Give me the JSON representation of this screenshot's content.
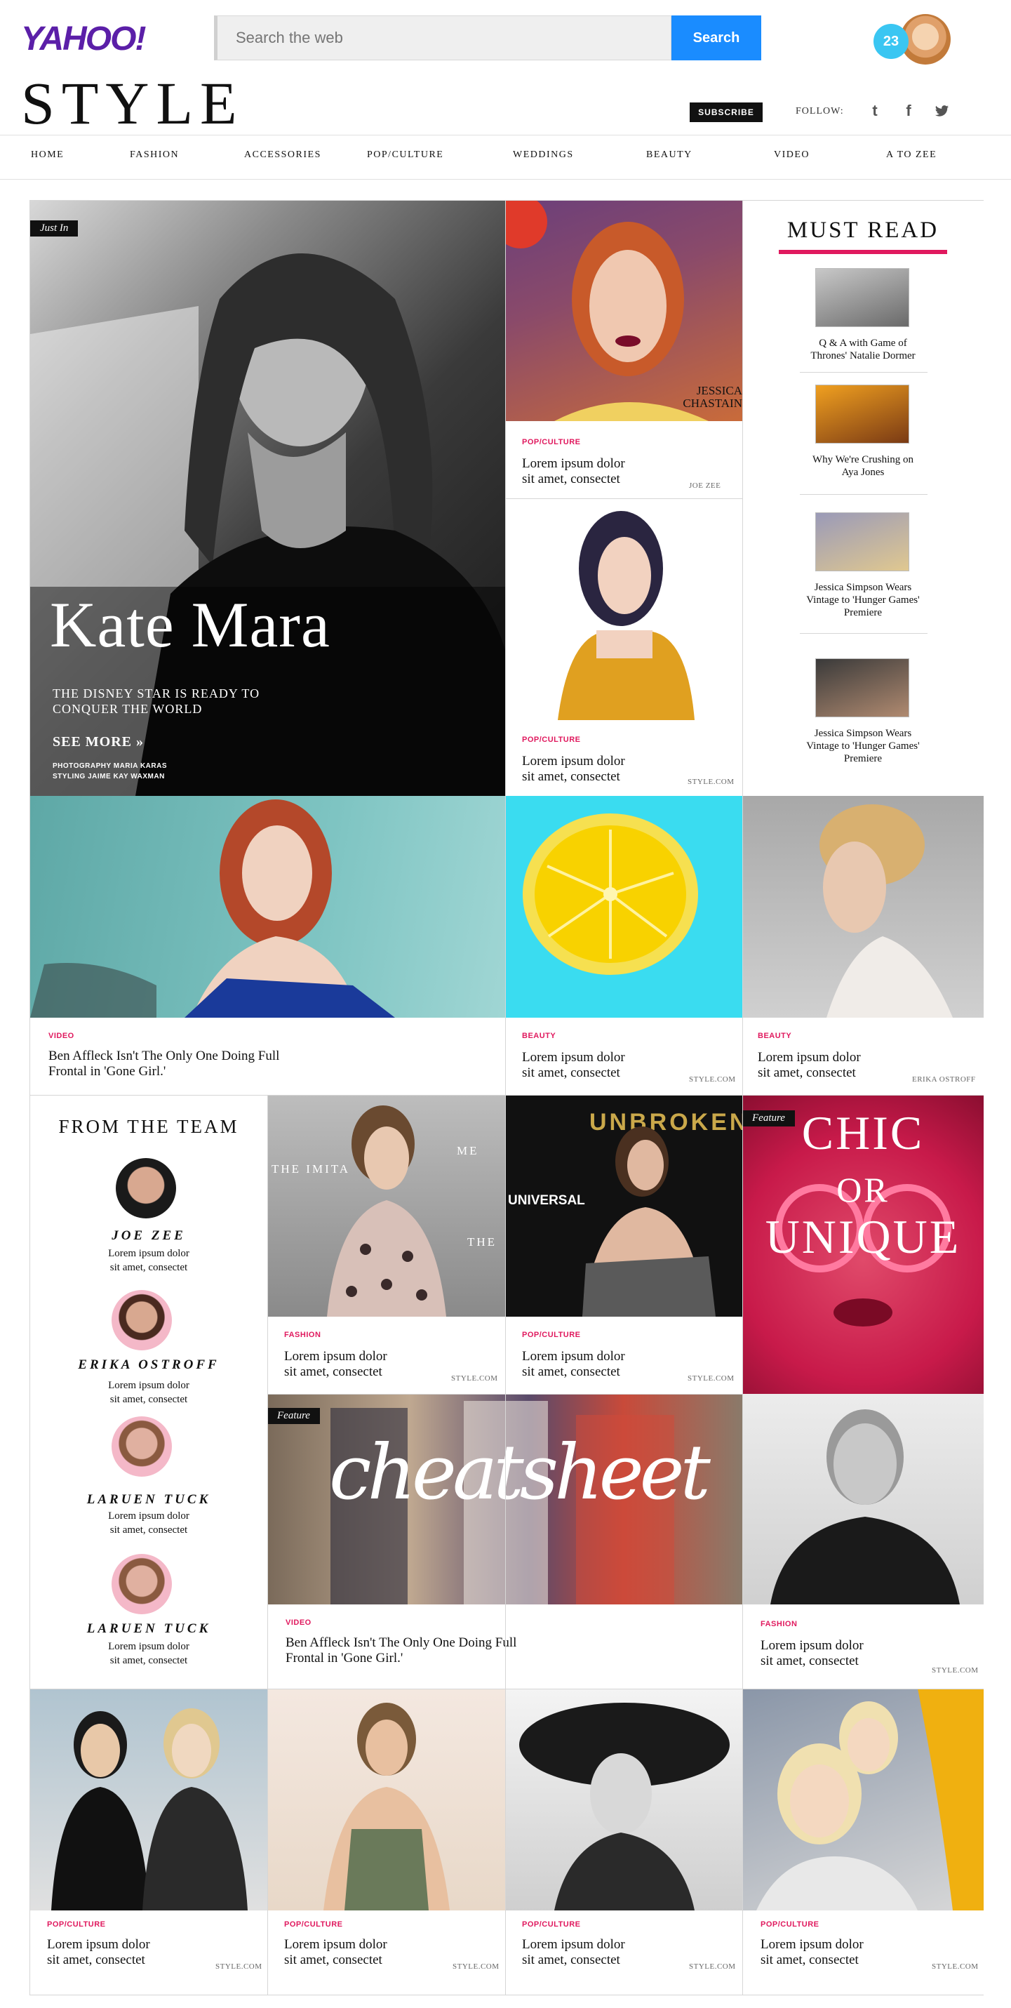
{
  "header": {
    "logo": "YAHOO!",
    "search_placeholder": "Search the web",
    "search_button": "Search",
    "notification_count": "23",
    "brand": "STYLE",
    "subscribe": "SUBSCRIBE",
    "follow_label": "FOLLOW:",
    "social": [
      "t",
      "f",
      "✔"
    ]
  },
  "nav": [
    "HOME",
    "FASHION",
    "ACCESSORIES",
    "POP/CULTURE",
    "WEDDINGS",
    "BEAUTY",
    "VIDEO",
    "A TO ZEE"
  ],
  "hero": {
    "tag": "Just In",
    "title": "Kate Mara",
    "subtitle_1": "THE DISNEY STAR IS READY TO",
    "subtitle_2": "CONQUER THE WORLD",
    "see_more": "SEE MORE »",
    "credit_1": "PHOTOGRAPHY MARIA KARAS",
    "credit_2": "STYLING JAIME KAY WAXMAN"
  },
  "jessica_overlay": {
    "line1": "JESSICA",
    "line2": "CHASTAIN"
  },
  "must_read": {
    "title": "MUST READ",
    "items": [
      {
        "l1": "Q & A with Game of",
        "l2": "Thrones' Natalie Dormer",
        "l3": ""
      },
      {
        "l1": "Why We're Crushing on",
        "l2": "Aya Jones",
        "l3": ""
      },
      {
        "l1": "Jessica Simpson Wears",
        "l2": "Vintage to 'Hunger Games'",
        "l3": "Premiere"
      },
      {
        "l1": "Jessica Simpson Wears",
        "l2": "Vintage to 'Hunger Games'",
        "l3": "Premiere"
      }
    ]
  },
  "cards": {
    "c1": {
      "cat": "POP/CULTURE",
      "l1": "Lorem ipsum dolor",
      "l2": "sit amet, consectet",
      "src": "JOE ZEE"
    },
    "c2": {
      "cat": "POP/CULTURE",
      "l1": "Lorem ipsum dolor",
      "l2": "sit amet, consectet",
      "src": "STYLE.COM"
    },
    "c3": {
      "cat": "VIDEO",
      "l1": "Ben Affleck Isn't The Only One Doing Full",
      "l2": "Frontal in 'Gone Girl.'",
      "src": ""
    },
    "c4": {
      "cat": "BEAUTY",
      "l1": "Lorem ipsum dolor",
      "l2": "sit amet, consectet",
      "src": "STYLE.COM"
    },
    "c5": {
      "cat": "BEAUTY",
      "l1": "Lorem ipsum dolor",
      "l2": "sit amet, consectet",
      "src": "ERIKA OSTROFF"
    },
    "c6": {
      "cat": "FASHION",
      "l1": "Lorem ipsum dolor",
      "l2": "sit amet, consectet",
      "src": "STYLE.COM"
    },
    "c7": {
      "cat": "POP/CULTURE",
      "l1": "Lorem ipsum dolor",
      "l2": "sit amet, consectet",
      "src": "STYLE.COM"
    },
    "c8": {
      "cat": "VIDEO",
      "l1": "Ben Affleck Isn't The Only One Doing Full",
      "l2": "Frontal in 'Gone Girl.'",
      "src": ""
    },
    "c9": {
      "cat": "FASHION",
      "l1": "Lorem ipsum dolor",
      "l2": "sit amet, consectet",
      "src": "STYLE.COM"
    },
    "c10": {
      "cat": "POP/CULTURE",
      "l1": "Lorem ipsum dolor",
      "l2": "sit amet, consectet",
      "src": "STYLE.COM"
    },
    "c11": {
      "cat": "POP/CULTURE",
      "l1": "Lorem ipsum dolor",
      "l2": "sit amet, consectet",
      "src": "STYLE.COM"
    },
    "c12": {
      "cat": "POP/CULTURE",
      "l1": "Lorem ipsum dolor",
      "l2": "sit amet, consectet",
      "src": "STYLE.COM"
    },
    "c13": {
      "cat": "POP/CULTURE",
      "l1": "Lorem ipsum dolor",
      "l2": "sit amet, consectet",
      "src": "STYLE.COM"
    }
  },
  "feature": {
    "tag": "Feature",
    "chic_1": "CHIC",
    "chic_2": "OR",
    "chic_3": "UNIQUE",
    "cheatsheet": "cheatsheet"
  },
  "event_text": {
    "imitation": "THE IMITA",
    "me": "ME",
    "the": "THE",
    "unbroken": "UNBROKEN",
    "universal": "UNIVERSAL"
  },
  "team": {
    "title": "FROM THE TEAM",
    "members": [
      {
        "name": "JOE ZEE",
        "l1": "Lorem ipsum dolor",
        "l2": "sit amet, consectet"
      },
      {
        "name": "ERIKA OSTROFF",
        "l1": "Lorem ipsum dolor",
        "l2": "sit amet, consectet"
      },
      {
        "name": "LARUEN TUCK",
        "l1": "Lorem ipsum dolor",
        "l2": "sit amet, consectet"
      },
      {
        "name": "LARUEN TUCK",
        "l1": "Lorem ipsum dolor",
        "l2": "sit amet, consectet"
      }
    ]
  },
  "colors": {
    "accent": "#e0195e",
    "yahoo_purple": "#5b1fa8",
    "search_blue": "#1a8cff",
    "must_read_rule": "#e0195e"
  }
}
